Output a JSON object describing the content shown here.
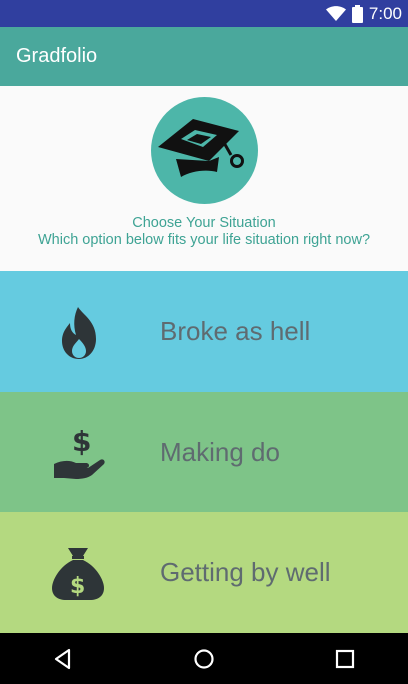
{
  "status_bar": {
    "time": "7:00",
    "icons": [
      "wifi-icon",
      "battery-icon"
    ]
  },
  "app_bar": {
    "title": "Gradfolio"
  },
  "header": {
    "logo_icon": "graduation-cap-icon",
    "heading": "Choose Your Situation",
    "subheading": "Which option below fits your life situation right now?"
  },
  "options": [
    {
      "label": "Broke as hell",
      "icon": "fire-icon",
      "color": "#65cbe0"
    },
    {
      "label": "Making do",
      "icon": "hand-money-icon",
      "color": "#7ec488"
    },
    {
      "label": "Getting by well",
      "icon": "money-bag-icon",
      "color": "#b4d980"
    }
  ],
  "nav_bar": {
    "buttons": [
      "back-icon",
      "home-icon",
      "recents-icon"
    ]
  },
  "colors": {
    "status_bar": "#303f9f",
    "app_bar": "#4aa89c",
    "accent_text": "#3ea394",
    "option_text": "#5f6b70"
  }
}
